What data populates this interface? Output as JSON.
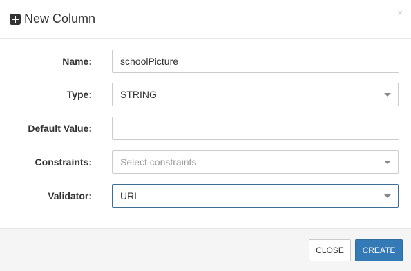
{
  "dialog": {
    "title": "New Column",
    "title_icon": "plus-square-icon",
    "close_glyph": "×"
  },
  "form": {
    "name": {
      "label": "Name:",
      "value": "schoolPicture"
    },
    "type": {
      "label": "Type:",
      "value": "STRING"
    },
    "default_value": {
      "label": "Default Value:",
      "value": ""
    },
    "constraints": {
      "label": "Constraints:",
      "placeholder": "Select constraints"
    },
    "validator": {
      "label": "Validator:",
      "value": "URL"
    }
  },
  "footer": {
    "close_label": "CLOSE",
    "create_label": "CREATE"
  },
  "colors": {
    "primary": "#337ab7",
    "focus_border": "#3b6f97",
    "footer_bg": "#f5f5f5"
  }
}
